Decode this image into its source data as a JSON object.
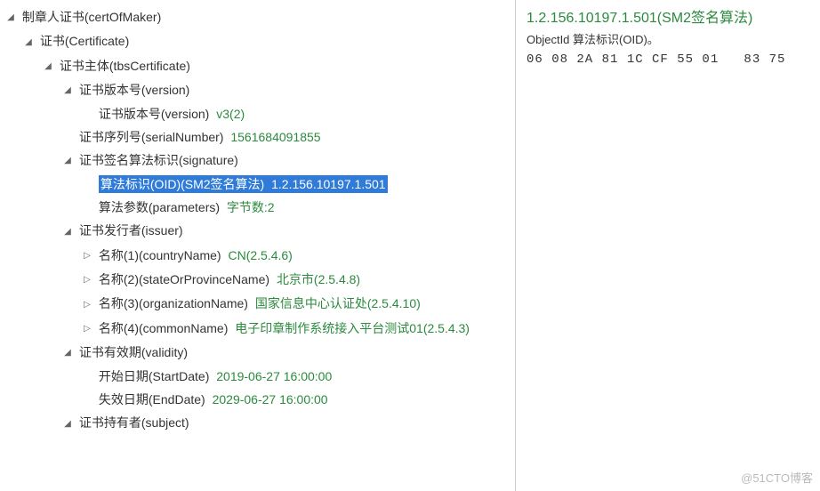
{
  "tree": {
    "root": {
      "label": "制章人证书(certOfMaker)"
    },
    "cert": {
      "label": "证书(Certificate)"
    },
    "tbs": {
      "label": "证书主体(tbsCertificate)"
    },
    "version_h": {
      "label": "证书版本号(version)"
    },
    "version_l": {
      "label": "证书版本号(version)",
      "val": "v3(2)"
    },
    "serial": {
      "label": "证书序列号(serialNumber)",
      "val": "1561684091855"
    },
    "sig": {
      "label": "证书签名算法标识(signature)"
    },
    "oid": {
      "label": "算法标识(OID)(SM2签名算法)",
      "val": "1.2.156.10197.1.501"
    },
    "params": {
      "label": "算法参数(parameters)",
      "val": "字节数:2"
    },
    "issuer": {
      "label": "证书发行者(issuer)"
    },
    "name1": {
      "label": "名称(1)(countryName)",
      "val": "CN(2.5.4.6)"
    },
    "name2": {
      "label": "名称(2)(stateOrProvinceName)",
      "val": "北京市(2.5.4.8)"
    },
    "name3": {
      "label": "名称(3)(organizationName)",
      "val": "国家信息中心认证处(2.5.4.10)"
    },
    "name4": {
      "label": "名称(4)(commonName)",
      "val": "电子印章制作系统接入平台测试01(2.5.4.3)"
    },
    "validity": {
      "label": "证书有效期(validity)"
    },
    "start": {
      "label": "开始日期(StartDate)",
      "val": "2019-06-27 16:00:00"
    },
    "end": {
      "label": "失效日期(EndDate)",
      "val": "2029-06-27 16:00:00"
    },
    "subject": {
      "label": "证书持有者(subject)"
    }
  },
  "arrows": {
    "down": "◢",
    "right": "▷"
  },
  "right": {
    "title": "1.2.156.10197.1.501(SM2签名算法)",
    "subtitle": "ObjectId  算法标识(OID)。",
    "hex": "06 08 2A 81 1C CF 55 01   83 75"
  },
  "watermark": "@51CTO博客"
}
